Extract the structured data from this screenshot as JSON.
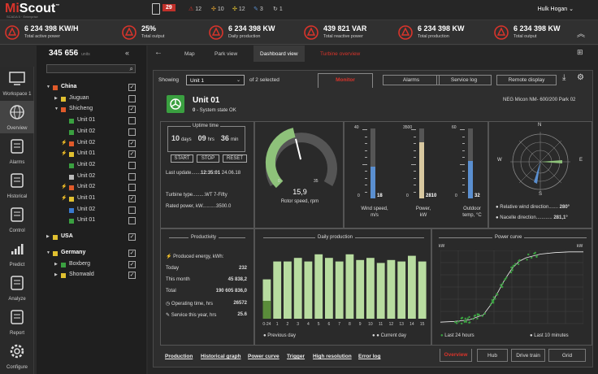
{
  "app": {
    "logo_a": "Mi",
    "logo_b": "Scout",
    "tm": "™",
    "tagline": "SCADA 5 · Enterprise",
    "user": "Hulk Hogan"
  },
  "topstats": {
    "notifications": "29",
    "s1": "12",
    "s2": "10",
    "s3": "12",
    "s4": "3",
    "s5": "1"
  },
  "kpis": [
    {
      "value": "6 234 398  KW/H",
      "label": "Total active power"
    },
    {
      "value": "25%",
      "label": "Total output"
    },
    {
      "value": "6 234 398 KW",
      "label": "Daily production"
    },
    {
      "value": "439 821 VAR",
      "label": "Total reactive power"
    },
    {
      "value": "6 234 398 KW",
      "label": "Total production"
    },
    {
      "value": "6 234 398 KW",
      "label": "Total output"
    }
  ],
  "nav": [
    "Workspace 1",
    "Overview",
    "Alarms",
    "Historical",
    "Control",
    "Predict",
    "Analyze",
    "Report",
    "Configure"
  ],
  "tree": {
    "count": "345 656",
    "unit": "units",
    "rows": [
      {
        "label": "China",
        "level": 0,
        "color": "#e05a2a",
        "arrow": "▼",
        "check": "✓"
      },
      {
        "label": "Jiuguan",
        "level": 1,
        "color": "#e0c030",
        "arrow": "▶",
        "check": ""
      },
      {
        "label": "Shicheng",
        "level": 1,
        "color": "#e05a2a",
        "arrow": "▼",
        "check": "✓"
      },
      {
        "label": "Unit 01",
        "level": 2,
        "color": "#3aa040",
        "icon": "",
        "check": ""
      },
      {
        "label": "Unit 02",
        "level": 2,
        "color": "#3aa040",
        "icon": "",
        "check": ""
      },
      {
        "label": "Unit 02",
        "level": 2,
        "color": "#e05a2a",
        "icon": "⚡",
        "check": "✓"
      },
      {
        "label": "Unit 01",
        "level": 2,
        "color": "#e0c030",
        "icon": "⚡",
        "check": "✓"
      },
      {
        "label": "Unit 02",
        "level": 2,
        "color": "#3aa040",
        "icon": "",
        "check": ""
      },
      {
        "label": "Unit 02",
        "level": 2,
        "color": "#bbbbbb",
        "icon": "",
        "check": ""
      },
      {
        "label": "Unit 02",
        "level": 2,
        "color": "#e05a2a",
        "icon": "⚡",
        "check": ""
      },
      {
        "label": "Unit 01",
        "level": 2,
        "color": "#e0c030",
        "icon": "⚡",
        "check": "✓"
      },
      {
        "label": "Unit 02",
        "level": 2,
        "color": "#3a7ad0",
        "icon": "",
        "check": ""
      },
      {
        "label": "Unit 01",
        "level": 2,
        "color": "#3aa040",
        "icon": "",
        "check": ""
      },
      {
        "label": "USA",
        "level": 0,
        "color": "#e0c030",
        "arrow": "▶",
        "check": "✓",
        "gap": true
      },
      {
        "label": "Germany",
        "level": 0,
        "color": "#e0c030",
        "arrow": "▼",
        "check": "✓",
        "gap": true
      },
      {
        "label": "Boxberg",
        "level": 1,
        "color": "#3aa040",
        "arrow": "▶",
        "check": "✓"
      },
      {
        "label": "Shonwald",
        "level": 1,
        "color": "#e0c030",
        "arrow": "▶",
        "check": "✓"
      }
    ]
  },
  "tabs": {
    "map": "Map",
    "park": "Park view",
    "dashboard": "Dashboard view",
    "turbine": "Turbine overview"
  },
  "panel": {
    "showing": "Showing",
    "unit_select": "Unit 1",
    "of_selected": "of 2 selected",
    "subtabs": [
      "Monitor",
      "Alarms",
      "Service log",
      "Remote display"
    ],
    "unit_name": "Unit 01",
    "state_code": "0",
    "state_text": "- System state OK",
    "model": "NEG Micon  NM- 600/200  Park 02"
  },
  "uptime": {
    "title": "Uptime time",
    "days": "10",
    "days_u": "days",
    "hrs": "09",
    "hrs_u": "hrs",
    "min": "36",
    "min_u": "min",
    "start": "START",
    "stop": "STOP",
    "reset": "RESET"
  },
  "info": {
    "lu_label": "Last update",
    "lu_time": "12:35:01",
    "lu_date": "24.06.18",
    "tt_label": "Turbine type",
    "tt_value": "WT 7-Fifty",
    "rp_label": "Rated power, kW",
    "rp_value": "3500.0"
  },
  "gauge": {
    "value": "15,9",
    "label": "Rotor speed, rpm",
    "min": "0",
    "max": "35",
    "fraction": 0.45
  },
  "bars": [
    {
      "label": "Wind speed,\nm/s",
      "l1": "Wind speed,",
      "l2": "m/s",
      "top": "40",
      "zero": "0",
      "value": "18",
      "fraction": 0.45,
      "color": "#5a8fd0"
    },
    {
      "label": "Power,",
      "l1": "Power,",
      "l2": "kW",
      "top": "3500",
      "zero": "0",
      "value": "2810",
      "fraction": 0.8,
      "color": "#d8c8a0"
    },
    {
      "label": "Outdoor temp",
      "l1": "Outdoor",
      "l2": "temp, °C",
      "top": "60",
      "zero": "0",
      "value": "32",
      "fraction": 0.53,
      "color": "#5a8fd0"
    }
  ],
  "compass": {
    "n": "N",
    "s": "S",
    "e": "E",
    "w": "W",
    "rwd_label": "Relative wind direction",
    "rwd_value": "280°",
    "nd_label": "Nacelle direction",
    "nd_value": "281,1°"
  },
  "productivity": {
    "title": "Productivity",
    "energy": "Produced energy, kWh:",
    "today_l": "Today",
    "today_v": "232",
    "month_l": "This month",
    "month_v": "45 838,2",
    "total_l": "Total",
    "total_v": "190 605 836,0",
    "op_l": "Operating time, hrs",
    "op_v": "26572",
    "serv_l": "Service this year, hrs",
    "serv_v": "25.6"
  },
  "daily": {
    "title": "Daily production",
    "legend_prev": "Previous day",
    "legend_cur": "Current day"
  },
  "power": {
    "title": "Power curve",
    "yl": "kW",
    "yr": "kW",
    "legend_a": "Last 24 hours",
    "legend_b": "Last 10 minutes"
  },
  "bottom_links": [
    "Production",
    "Historical graph",
    "Power curve",
    "Trigger",
    "High resolution",
    "Error log"
  ],
  "bottom_tabs": [
    "Overview",
    "Hub",
    "Drive train",
    "Grid"
  ],
  "chart_data": [
    {
      "type": "bar",
      "title": "Daily production",
      "categories": [
        "0-24",
        "1",
        "2",
        "3",
        "4",
        "5",
        "6",
        "7",
        "8",
        "9",
        "10",
        "11",
        "12",
        "13",
        "14",
        "15"
      ],
      "series": [
        {
          "name": "Previous day",
          "values": [
            0.55,
            0.8,
            0.8,
            0.85,
            0.8,
            0.9,
            0.85,
            0.8,
            0.9,
            0.82,
            0.85,
            0.78,
            0.82,
            0.8,
            0.88,
            0.8
          ]
        },
        {
          "name": "Current day",
          "values": [
            0.25,
            0,
            0,
            0,
            0,
            0,
            0,
            0,
            0,
            0,
            0,
            0,
            0,
            0,
            0,
            0
          ]
        }
      ]
    },
    {
      "type": "scatter",
      "title": "Power curve",
      "curve": [
        [
          0,
          0.02
        ],
        [
          0.1,
          0.03
        ],
        [
          0.2,
          0.05
        ],
        [
          0.3,
          0.12
        ],
        [
          0.35,
          0.25
        ],
        [
          0.4,
          0.42
        ],
        [
          0.45,
          0.6
        ],
        [
          0.5,
          0.75
        ],
        [
          0.55,
          0.85
        ],
        [
          0.6,
          0.9
        ],
        [
          0.7,
          0.95
        ],
        [
          0.8,
          0.97
        ],
        [
          0.9,
          0.98
        ],
        [
          1,
          0.98
        ]
      ]
    }
  ]
}
